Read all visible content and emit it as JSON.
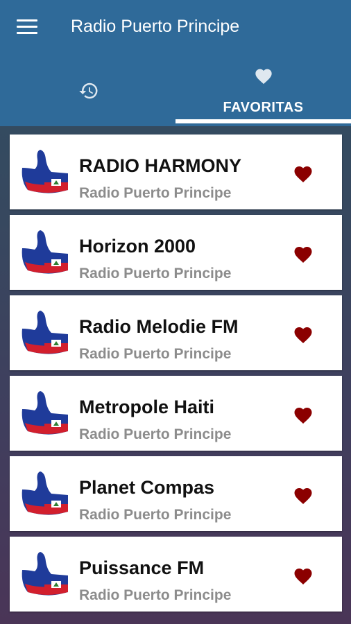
{
  "app": {
    "title": "Radio Puerto Principe"
  },
  "tabs": {
    "recent": {
      "icon": "history-icon"
    },
    "favorites": {
      "label": "FAVORITAS",
      "icon": "heart-icon"
    }
  },
  "colors": {
    "primary": "#2f6a99",
    "heart": "#8b0000",
    "subtitle": "#8c8c8c"
  },
  "stations": [
    {
      "name": "RADIO HARMONY",
      "subtitle": "Radio Puerto Principe"
    },
    {
      "name": "Horizon 2000",
      "subtitle": "Radio Puerto Principe"
    },
    {
      "name": "Radio Melodie FM",
      "subtitle": "Radio Puerto Principe"
    },
    {
      "name": "Metropole Haiti",
      "subtitle": "Radio Puerto Principe"
    },
    {
      "name": "Planet Compas",
      "subtitle": "Radio Puerto Principe"
    },
    {
      "name": "Puissance FM",
      "subtitle": "Radio Puerto Principe"
    }
  ]
}
